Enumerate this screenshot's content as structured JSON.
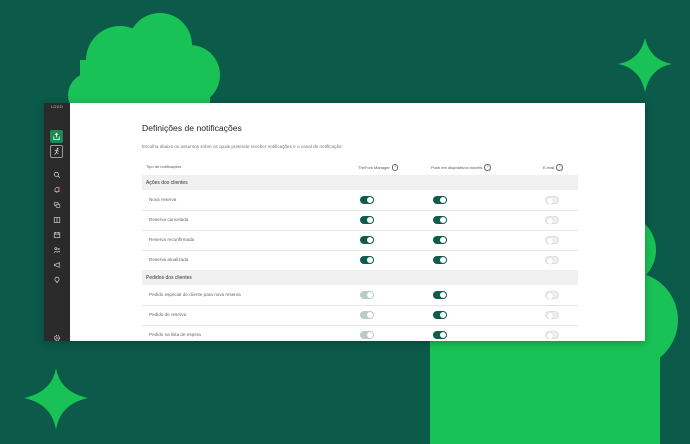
{
  "sidebar": {
    "logo": "LOGO",
    "icons": [
      "share-icon",
      "run-icon",
      "search-icon",
      "bell-icon",
      "chat-icon",
      "book-icon",
      "calendar-icon",
      "people-icon",
      "megaphone-icon",
      "bulb-icon",
      "settings-icon"
    ]
  },
  "page": {
    "title": "Definições de notificações",
    "subtitle": "Escolha abaixo os assuntos sobre os quais pretende receber notificações e o canal de notificação:"
  },
  "columns": {
    "type": "Tipo de notificações",
    "manager": "TheFork Manager",
    "push": "Push em dispositivos móveis",
    "email": "E-mail",
    "help": "?"
  },
  "sections": [
    {
      "title": "Ações dos clientes",
      "rows": [
        {
          "label": "Nova reserva",
          "manager": "on",
          "push": "on",
          "email": "off"
        },
        {
          "label": "Reserva cancelada",
          "manager": "on",
          "push": "on",
          "email": "off"
        },
        {
          "label": "Reserva reconfirmada",
          "manager": "on",
          "push": "on",
          "email": "off"
        },
        {
          "label": "Reserva atualizada",
          "manager": "on",
          "push": "on",
          "email": "off"
        }
      ]
    },
    {
      "title": "Pedidos dos clientes",
      "rows": [
        {
          "label": "Pedido especial do cliente para nova reserva",
          "manager": "on-disabled",
          "push": "on",
          "email": "off"
        },
        {
          "label": "Pedido de reserva",
          "manager": "on-disabled",
          "push": "on",
          "email": "off"
        },
        {
          "label": "Pedido na lista de espera",
          "manager": "on-disabled",
          "push": "on",
          "email": "off"
        }
      ]
    }
  ],
  "colors": {
    "background": "#0b5a4a",
    "decoration": "#19c256",
    "toggle_on": "#0f5c4a",
    "rail": "#2a2a2a",
    "rail_active": "#1b8a54"
  }
}
